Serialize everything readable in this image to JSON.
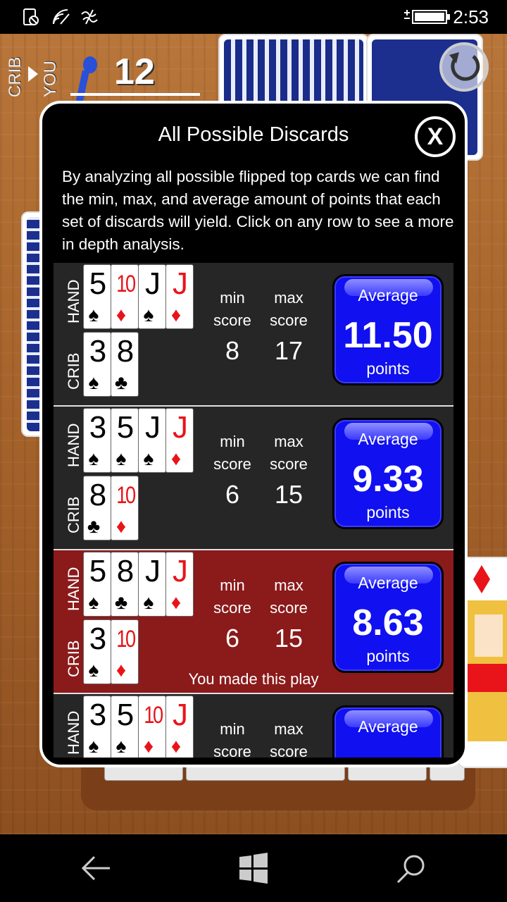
{
  "status": {
    "time": "2:53"
  },
  "game": {
    "score": "12",
    "crib_label": "CRIB",
    "you_label": "YOU"
  },
  "dialog": {
    "title": "All Possible Discards",
    "close_label": "X",
    "description": "By analyzing all possible flipped top cards we can find the min, max, and average amount of points that each set of discards will yield.  Click on any row to see a more in depth analysis.",
    "hand_label": "HAND",
    "crib_label": "CRIB",
    "min_label": "min",
    "max_label": "max",
    "score_label": "score",
    "average_label": "Average",
    "points_label": "points",
    "rows": [
      {
        "hand": [
          {
            "rank": "5",
            "suit": "♠",
            "color": "black"
          },
          {
            "rank": "10",
            "suit": "♦",
            "color": "red"
          },
          {
            "rank": "J",
            "suit": "♠",
            "color": "black"
          },
          {
            "rank": "J",
            "suit": "♦",
            "color": "red"
          }
        ],
        "crib": [
          {
            "rank": "3",
            "suit": "♠",
            "color": "black"
          },
          {
            "rank": "8",
            "suit": "♣",
            "color": "black"
          }
        ],
        "min": "8",
        "max": "17",
        "average": "11.50",
        "selected": false,
        "note": ""
      },
      {
        "hand": [
          {
            "rank": "3",
            "suit": "♠",
            "color": "black"
          },
          {
            "rank": "5",
            "suit": "♠",
            "color": "black"
          },
          {
            "rank": "J",
            "suit": "♠",
            "color": "black"
          },
          {
            "rank": "J",
            "suit": "♦",
            "color": "red"
          }
        ],
        "crib": [
          {
            "rank": "8",
            "suit": "♣",
            "color": "black"
          },
          {
            "rank": "10",
            "suit": "♦",
            "color": "red"
          }
        ],
        "min": "6",
        "max": "15",
        "average": "9.33",
        "selected": false,
        "note": ""
      },
      {
        "hand": [
          {
            "rank": "5",
            "suit": "♠",
            "color": "black"
          },
          {
            "rank": "8",
            "suit": "♣",
            "color": "black"
          },
          {
            "rank": "J",
            "suit": "♠",
            "color": "black"
          },
          {
            "rank": "J",
            "suit": "♦",
            "color": "red"
          }
        ],
        "crib": [
          {
            "rank": "3",
            "suit": "♠",
            "color": "black"
          },
          {
            "rank": "10",
            "suit": "♦",
            "color": "red"
          }
        ],
        "min": "6",
        "max": "15",
        "average": "8.63",
        "selected": true,
        "note": "You made this play"
      },
      {
        "hand": [
          {
            "rank": "3",
            "suit": "♠",
            "color": "black"
          },
          {
            "rank": "5",
            "suit": "♠",
            "color": "black"
          },
          {
            "rank": "10",
            "suit": "♦",
            "color": "red"
          },
          {
            "rank": "J",
            "suit": "♦",
            "color": "red"
          }
        ],
        "crib": [],
        "min": "",
        "max": "",
        "average": "",
        "selected": false,
        "note": ""
      }
    ]
  },
  "colors": {
    "average_button": "#1010f0",
    "selected_row": "#8b1a1a",
    "row_bg": "#262626"
  }
}
